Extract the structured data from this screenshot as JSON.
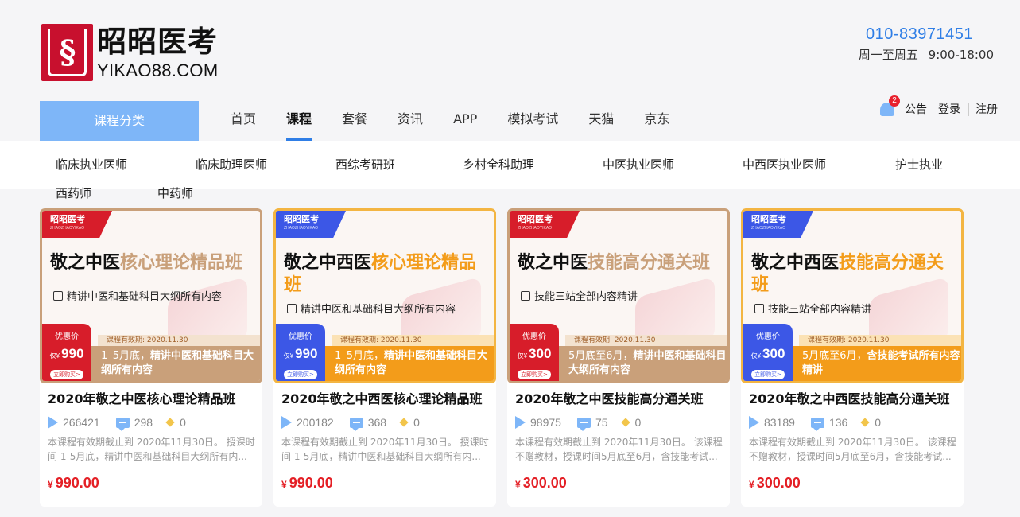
{
  "brand": {
    "cn": "昭昭医考",
    "en": "YIKAO88.COM"
  },
  "contact": {
    "phone": "010-83971451",
    "hours": "周一至周五 9:00-18:00"
  },
  "category_button": "课程分类",
  "nav": [
    "首页",
    "课程",
    "套餐",
    "资讯",
    "APP",
    "模拟考试",
    "天猫",
    "京东"
  ],
  "nav_active": "课程",
  "user": {
    "notice_count": "2",
    "notice": "公告",
    "login": "登录",
    "register": "注册"
  },
  "subcategories": [
    "临床执业医师",
    "临床助理医师",
    "西综考研班",
    "乡村全科助理",
    "中医执业医师",
    "中西医执业医师",
    "护士执业",
    "西药师",
    "中药师"
  ],
  "colors": {
    "accent": "#2f7ee6",
    "price": "#e41f25",
    "category_bg": "#7eb6f8"
  },
  "cards": [
    {
      "banner": {
        "brand": "昭昭医考",
        "brand_en": "ZHAOZHAOYIKAO",
        "title_black": "敬之中医",
        "title_color": "核心理论精品班",
        "bullet": "精讲中医和基础科目大纲所有内容",
        "validity": "课程有效期: 2020.11.30",
        "price_label": "优惠价",
        "price_prefix": "仅¥",
        "price_value": "990",
        "buy": "立即购买>",
        "strip_prefix": "1–5月底，",
        "strip_rest": "精讲中医和基础科目大纲所有内容"
      },
      "title": "2020年敬之中医核心理论精品班",
      "plays": "266421",
      "comments": "298",
      "likes": "0",
      "desc": "本课程有效期截止到 2020年11月30日。 授课时间 1-5月底，精讲中医和基础科目大纲所有内...",
      "currency": "¥",
      "price": "990.00"
    },
    {
      "banner": {
        "brand": "昭昭医考",
        "brand_en": "ZHAOZHAOYIKAO",
        "title_black": "敬之中西医",
        "title_color": "核心理论精品班",
        "bullet": "精讲中医和基础科目大纲所有内容",
        "validity": "课程有效期: 2020.11.30",
        "price_label": "优惠价",
        "price_prefix": "仅¥",
        "price_value": "990",
        "buy": "立即购买>",
        "strip_prefix": "1–5月底，",
        "strip_rest": "精讲中医和基础科目大纲所有内容"
      },
      "title": "2020年敬之中西医核心理论精品班",
      "plays": "200182",
      "comments": "368",
      "likes": "0",
      "desc": "本课程有效期截止到 2020年11月30日。 授课时间 1-5月底，精讲中医和基础科目大纲所有内...",
      "currency": "¥",
      "price": "990.00"
    },
    {
      "banner": {
        "brand": "昭昭医考",
        "brand_en": "ZHAOZHAOYIKAO",
        "title_black": "敬之中医",
        "title_color": "技能高分通关班",
        "bullet": "技能三站全部内容精讲",
        "validity": "课程有效期: 2020.11.30",
        "price_label": "优惠价",
        "price_prefix": "仅¥",
        "price_value": "300",
        "buy": "立即购买>",
        "strip_prefix": "5月底至6月，",
        "strip_rest": "精讲中医和基础科目大纲所有内容"
      },
      "title": "2020年敬之中医技能高分通关班",
      "plays": "98975",
      "comments": "75",
      "likes": "0",
      "desc": "本课程有效期截止到 2020年11月30日。 该课程不赠教材，授课时间5月底至6月，含技能考试...",
      "currency": "¥",
      "price": "300.00"
    },
    {
      "banner": {
        "brand": "昭昭医考",
        "brand_en": "ZHAOZHAOYIKAO",
        "title_black": "敬之中西医",
        "title_color": "技能高分通关班",
        "bullet": "技能三站全部内容精讲",
        "validity": "课程有效期: 2020.11.30",
        "price_label": "优惠价",
        "price_prefix": "仅¥",
        "price_value": "300",
        "buy": "立即购买>",
        "strip_prefix": "5月底至6月，",
        "strip_rest": "含技能考试所有内容精讲"
      },
      "title": "2020年敬之中西医技能高分通关班",
      "plays": "83189",
      "comments": "136",
      "likes": "0",
      "desc": "本课程有效期截止到 2020年11月30日。 该课程不赠教材，授课时间5月底至6月，含技能考试...",
      "currency": "¥",
      "price": "300.00"
    }
  ]
}
